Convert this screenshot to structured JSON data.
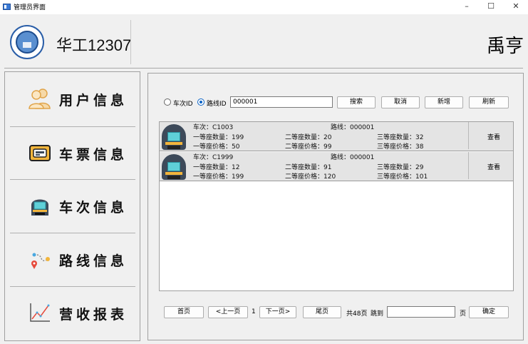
{
  "window": {
    "title": "管理员界面",
    "min_symbol": "–",
    "max_symbol": "☐",
    "close_symbol": "✕"
  },
  "header": {
    "app_name": "华工12307",
    "user_name": "禹亨"
  },
  "sidebar": {
    "items": [
      {
        "label": "用户信息",
        "icon": "users-icon"
      },
      {
        "label": "车票信息",
        "icon": "ticket-icon"
      },
      {
        "label": "车次信息",
        "icon": "train-icon"
      },
      {
        "label": "路线信息",
        "icon": "route-icon"
      },
      {
        "label": "营收报表",
        "icon": "chart-icon"
      }
    ]
  },
  "search": {
    "radio_train_label": "车次ID",
    "radio_route_label": "路线ID",
    "selected": "路线ID",
    "value": "000001",
    "search_button": "搜索",
    "cancel_button": "取消",
    "add_button": "新增",
    "refresh_button": "刷新"
  },
  "results": [
    {
      "train": "车次：C1003",
      "route": "路线：000001",
      "first_count": "一等座数量：199",
      "second_count": "二等座数量：20",
      "third_count": "三等座数量：32",
      "first_price": "一等座价格：50",
      "second_price": "二等座价格：99",
      "third_price": "三等座价格：38",
      "view_label": "查看"
    },
    {
      "train": "车次：C1999",
      "route": "路线：000001",
      "first_count": "一等座数量：12",
      "second_count": "二等座数量：91",
      "third_count": "三等座数量：29",
      "first_price": "一等座价格：199",
      "second_price": "二等座价格：120",
      "third_price": "三等座价格：101",
      "view_label": "查看"
    }
  ],
  "pager": {
    "first": "首页",
    "prev": "<上一页",
    "current": "1",
    "next": "下一页>",
    "last": "尾页",
    "total": "共48页",
    "jump_label": "跳到",
    "page_unit": "页",
    "confirm": "确定"
  },
  "colors": {
    "accent": "#0b63c5",
    "row_bg": "#e4e4e4"
  }
}
